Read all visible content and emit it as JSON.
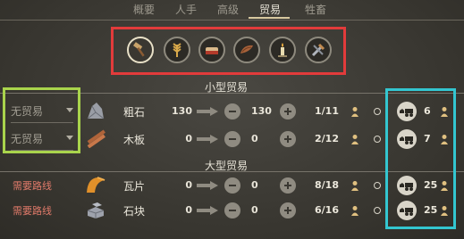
{
  "tabs": [
    "概要",
    "人手",
    "高级",
    "贸易",
    "牲畜"
  ],
  "active_tab": 3,
  "category_icons": [
    "hammer-icon",
    "wheat-icon",
    "bread-icon",
    "leather-icon",
    "candle-icon",
    "tools-icon"
  ],
  "sections": {
    "small": {
      "title": "小型贸易"
    },
    "large": {
      "title": "大型贸易"
    }
  },
  "trades": [
    {
      "status": "无贸易",
      "kind": "dropdown",
      "name": "粗石",
      "icon": "stone-icon",
      "left": "130",
      "right": "130",
      "ratio": "1/11",
      "carts": "6"
    },
    {
      "status": "无贸易",
      "kind": "dropdown",
      "name": "木板",
      "icon": "plank-icon",
      "left": "0",
      "right": "0",
      "ratio": "2/12",
      "carts": "7"
    },
    {
      "status": "需要路线",
      "kind": "req",
      "name": "瓦片",
      "icon": "tile-icon",
      "left": "0",
      "right": "0",
      "ratio": "8/18",
      "carts": "25"
    },
    {
      "status": "需要路线",
      "kind": "req",
      "name": "石块",
      "icon": "block-icon",
      "left": "0",
      "right": "0",
      "ratio": "6/16",
      "carts": "25"
    }
  ],
  "colors": {
    "highlight_red": "#e23b3b",
    "highlight_green": "#a9d44c",
    "highlight_cyan": "#33c6d0",
    "req_text": "#e07a6a"
  }
}
